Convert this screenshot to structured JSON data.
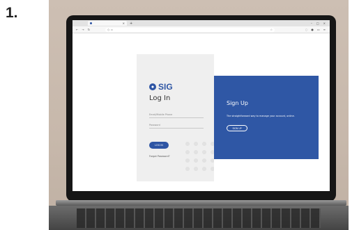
{
  "step": {
    "number": "1."
  },
  "browser": {
    "url": "",
    "colors": {
      "tabbar": "#e3e3e3",
      "toolbar": "#f7f7f7"
    }
  },
  "login": {
    "logo_text": "SIG",
    "title": "Log In",
    "email_placeholder": "Email/Mobile Phone",
    "password_placeholder": "Password",
    "login_button": "LOG IN",
    "forgot_link": "Forgot Password?"
  },
  "signup": {
    "title": "Sign Up",
    "description": "The straightforward way to manage your account, online.",
    "button": "SIGN UP"
  },
  "colors": {
    "brand": "#2e55a4",
    "signup_bg": "#2f57a5",
    "login_bg": "#efefef"
  },
  "icons": {
    "tab": "tab-favicon",
    "back": "back-icon",
    "forward": "forward-icon",
    "reload": "reload-icon",
    "shield": "shield-icon",
    "lock": "lock-icon",
    "star": "bookmark-star-icon",
    "menu": "menu-icon"
  }
}
